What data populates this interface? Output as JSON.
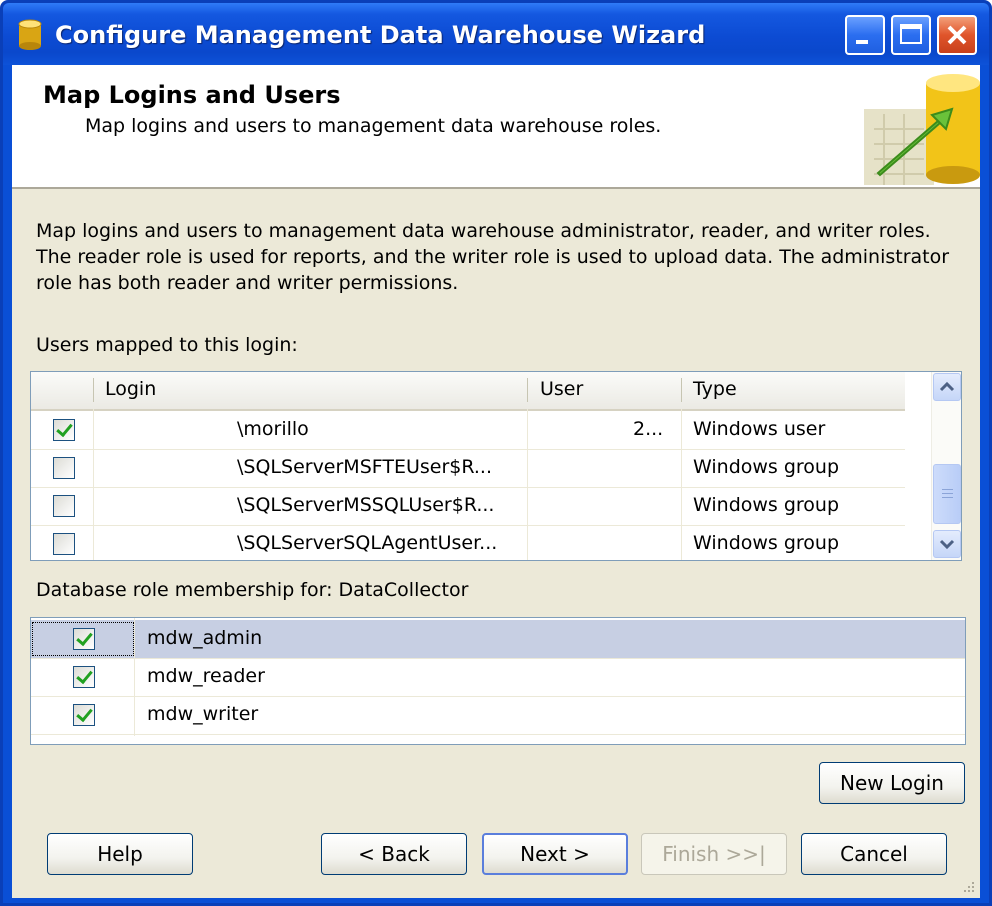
{
  "window": {
    "title": "Configure Management Data Warehouse Wizard"
  },
  "banner": {
    "title": "Map Logins and Users",
    "subtitle": "Map logins and users to management data warehouse roles."
  },
  "description": "Map logins and users to management data warehouse administrator, reader, and writer roles. The reader role is used for reports, and the writer role is used to upload data. The administrator role has both reader and writer permissions.",
  "users_section": {
    "label": "Users mapped to this login:",
    "columns": [
      "Login",
      "User",
      "Type"
    ],
    "rows": [
      {
        "checked": true,
        "login": "\\morillo",
        "user": "2...",
        "type": "Windows user"
      },
      {
        "checked": false,
        "login": "\\SQLServerMSFTEUser$R...",
        "user": "",
        "type": "Windows group"
      },
      {
        "checked": false,
        "login": "\\SQLServerMSSQLUser$R...",
        "user": "",
        "type": "Windows group"
      },
      {
        "checked": false,
        "login": "\\SQLServerSQLAgentUser...",
        "user": "",
        "type": "Windows group"
      }
    ]
  },
  "roles_section": {
    "label": "Database role membership for: DataCollector",
    "rows": [
      {
        "checked": true,
        "role": "mdw_admin",
        "selected": true
      },
      {
        "checked": true,
        "role": "mdw_reader",
        "selected": false
      },
      {
        "checked": true,
        "role": "mdw_writer",
        "selected": false
      }
    ]
  },
  "buttons": {
    "new_login": "New Login",
    "help": "Help",
    "back": "< Back",
    "next": "Next >",
    "finish": "Finish >>|",
    "cancel": "Cancel"
  },
  "icons": {
    "title": "database-cylinder-icon",
    "banner": "database-arrow-graphic",
    "scroll_up": "chevron-up-icon",
    "scroll_down": "chevron-down-icon"
  }
}
